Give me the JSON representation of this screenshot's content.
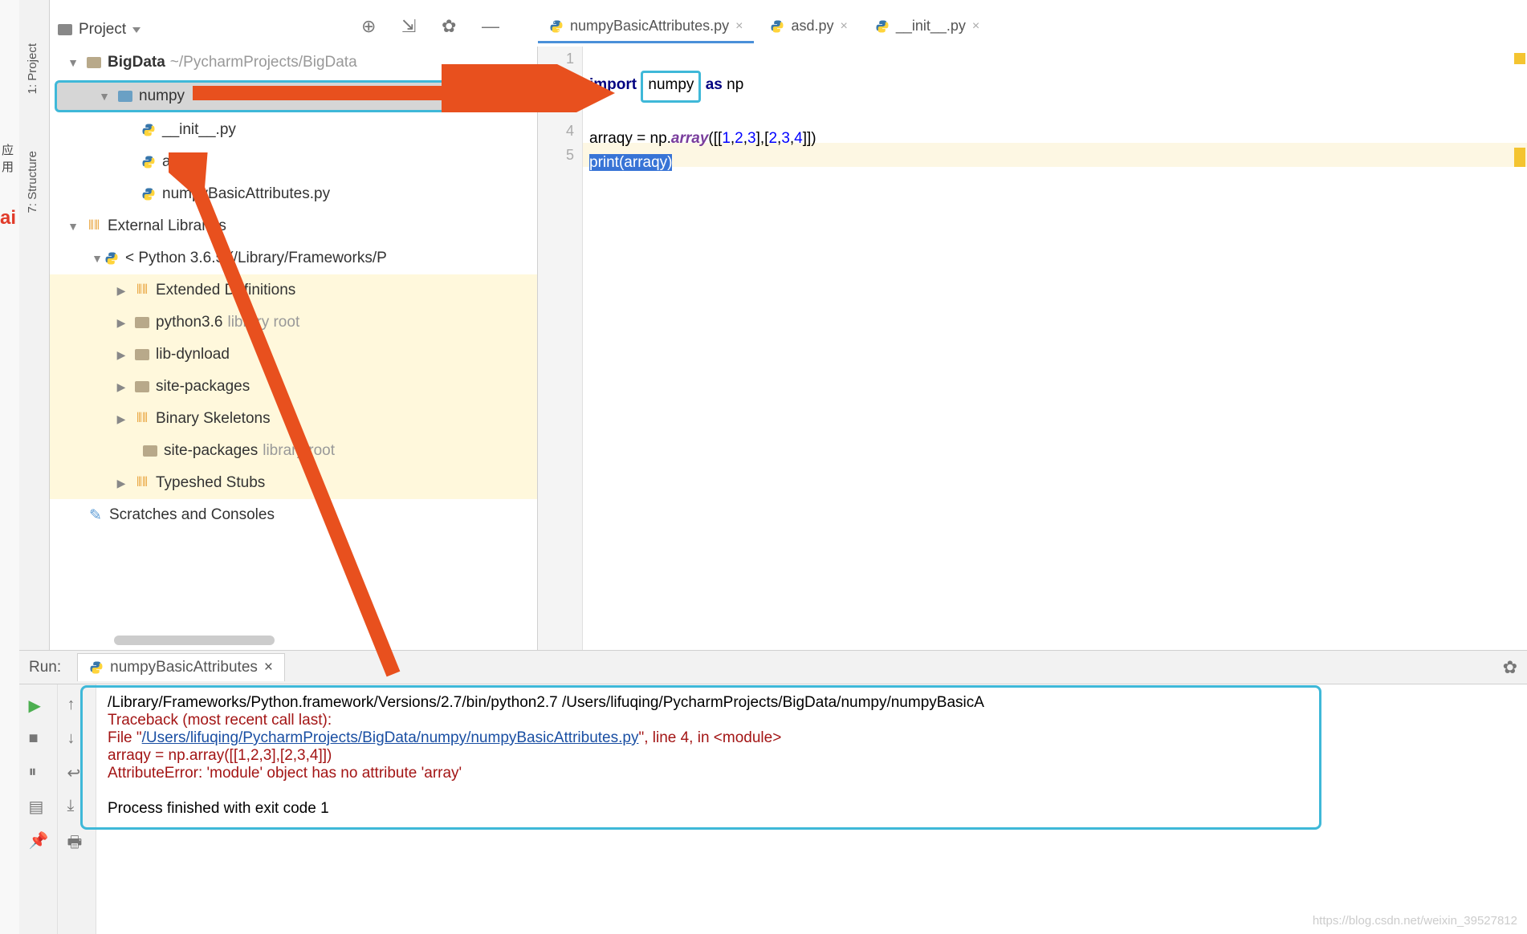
{
  "browser": {
    "app_label": "应用"
  },
  "leftbar": {
    "project_tab": "1: Project",
    "structure_tab": "7: Structure"
  },
  "project_header": {
    "label": "Project"
  },
  "tree": {
    "root": {
      "name": "BigData",
      "path": "~/PycharmProjects/BigData"
    },
    "numpy_folder": "numpy",
    "files": {
      "init": "__init__.py",
      "asd": "asd.py",
      "nba": "numpyBasicAttributes.py"
    },
    "ext_lib": "External Libraries",
    "python": "< Python 3.6.5 (/Library/Frameworks/P",
    "ext_def": "Extended Definitions",
    "py36": "python3.6",
    "py36_note": "library root",
    "libdyn": "lib-dynload",
    "sp1": "site-packages",
    "binsk": "Binary Skeletons",
    "sp2": "site-packages",
    "sp2_note": "library root",
    "typeshed": "Typeshed Stubs",
    "scratches": "Scratches and Consoles"
  },
  "tabs": {
    "t1": "numpyBasicAttributes.py",
    "t2": "asd.py",
    "t3": "__init__.py"
  },
  "code": {
    "l1": "",
    "l2_import": "import",
    "l2_numpy": "numpy",
    "l2_as": "as",
    "l2_np": "np",
    "l3": "",
    "l4_a": "arraqy = np.",
    "l4_fn": "array",
    "l4_b": "([[",
    "l4_n1": "1",
    "l4_c": ",",
    "l4_n2": "2",
    "l4_n3": "3",
    "l4_d": "],[",
    "l4_n4": "2",
    "l4_n5": "3",
    "l4_n6": "4",
    "l4_e": "]])",
    "l5_print": "print",
    "l5_arg": "(arraqy)"
  },
  "gutter": {
    "g1": "1",
    "g2": "2",
    "g3": "3",
    "g4": "4",
    "g5": "5"
  },
  "run": {
    "label": "Run:",
    "tab": "numpyBasicAttributes",
    "line1": "/Library/Frameworks/Python.framework/Versions/2.7/bin/python2.7 /Users/lifuqing/PycharmProjects/BigData/numpy/numpyBasicA",
    "line2": "Traceback (most recent call last):",
    "line3a": "  File \"",
    "line3_link": "/Users/lifuqing/PycharmProjects/BigData/numpy/numpyBasicAttributes.py",
    "line3b": "\", line 4, in <module>",
    "line4": "    arraqy = np.array([[1,2,3],[2,3,4]])",
    "line5": "AttributeError: 'module' object has no attribute 'array'",
    "line7": "Process finished with exit code 1"
  },
  "watermark": "https://blog.csdn.net/weixin_39527812"
}
